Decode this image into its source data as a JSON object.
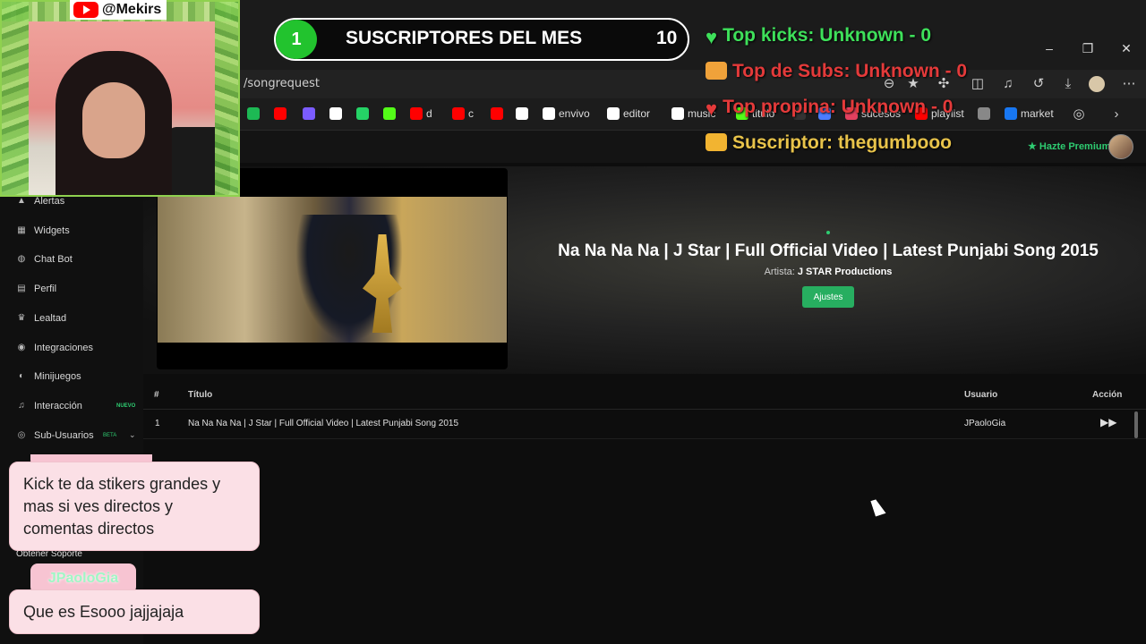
{
  "browser": {
    "url": "/songrequest",
    "bookmarks": [
      {
        "label": "",
        "icon": "spotify-icon",
        "color": "#1db954"
      },
      {
        "label": "",
        "icon": "youtube-icon",
        "color": "#ff0000"
      },
      {
        "label": "",
        "icon": "app-icon",
        "color": "#7b5cff"
      },
      {
        "label": "",
        "icon": "chatgpt-icon",
        "color": "#ffffff"
      },
      {
        "label": "",
        "icon": "whatsapp-icon",
        "color": "#25d366"
      },
      {
        "label": "",
        "icon": "kick-icon",
        "color": "#53fc18"
      },
      {
        "label": "d",
        "icon": "youtube-icon",
        "color": "#ff0000"
      },
      {
        "label": "c",
        "icon": "youtube-icon",
        "color": "#ff0000"
      },
      {
        "label": "",
        "icon": "youtube-icon",
        "color": "#ff0000"
      },
      {
        "label": "",
        "icon": "tiktok-icon",
        "color": "#ffffff"
      },
      {
        "label": "envivo",
        "icon": "tiktok-icon",
        "color": "#ffffff"
      },
      {
        "label": "editor",
        "icon": "tiktok-icon",
        "color": "#ffffff"
      },
      {
        "label": "music",
        "icon": "music-icon",
        "color": "#ffffff"
      },
      {
        "label": "titulo",
        "icon": "kick-icon",
        "color": "#53fc18"
      },
      {
        "label": "",
        "icon": "app-icon",
        "color": "#333333"
      },
      {
        "label": "",
        "icon": "app-icon",
        "color": "#4a7cff"
      },
      {
        "label": "sucesos",
        "icon": "app-icon",
        "color": "#e4405f"
      },
      {
        "label": "playlist",
        "icon": "youtube-icon",
        "color": "#ff0000"
      },
      {
        "label": "",
        "icon": "app-icon",
        "color": "#888888"
      },
      {
        "label": "market",
        "icon": "facebook-icon",
        "color": "#1877f2"
      }
    ]
  },
  "sidebar": {
    "items": [
      {
        "label": "Alertas",
        "icon": "bell-icon"
      },
      {
        "label": "Widgets",
        "icon": "grid-icon"
      },
      {
        "label": "Chat Bot",
        "icon": "bot-icon"
      },
      {
        "label": "Perfil",
        "icon": "profile-icon"
      },
      {
        "label": "Lealtad",
        "icon": "trophy-icon"
      },
      {
        "label": "Integraciones",
        "icon": "plug-icon"
      },
      {
        "label": "Minijuegos",
        "icon": "gamepad-icon"
      },
      {
        "label": "Interacción",
        "icon": "music-icon",
        "badge": "NUEVO"
      },
      {
        "label": "Sub-Usuarios",
        "icon": "users-icon",
        "badge": "BETA"
      }
    ],
    "support": "Obtener Soporte"
  },
  "header": {
    "premium": "Hazte Premium"
  },
  "now_playing": {
    "title": "Na Na Na Na | J Star | Full Official Video | Latest Punjabi Song 2015",
    "artist_label": "Artista:",
    "artist": "J STAR Productions",
    "settings_button": "Ajustes"
  },
  "queue": {
    "columns": [
      "#",
      "Título",
      "Usuario",
      "Acción"
    ],
    "rows": [
      {
        "index": "1",
        "title": "Na Na Na Na | J Star | Full Official Video | Latest Punjabi Song 2015",
        "user": "JPaoloGia"
      }
    ]
  },
  "stream_overlay": {
    "handle": "@Mekirs",
    "subs_month": {
      "rank": "1",
      "title": "SUSCRIPTORES DEL MES",
      "count": "10"
    },
    "top_kicks": "Top kicks: Unknown - 0",
    "top_subs": "Top de Subs: Unknown - 0",
    "top_propina": "Top propina: Unknown - 0",
    "suscriptor": "Suscriptor: thegumbooo",
    "chat": [
      {
        "user": "",
        "message": "Kick te da stikers grandes y mas si ves directos y comentas directos"
      },
      {
        "user": "JPaoloGia",
        "message": "Que es Esooo jajjajaja"
      }
    ]
  }
}
